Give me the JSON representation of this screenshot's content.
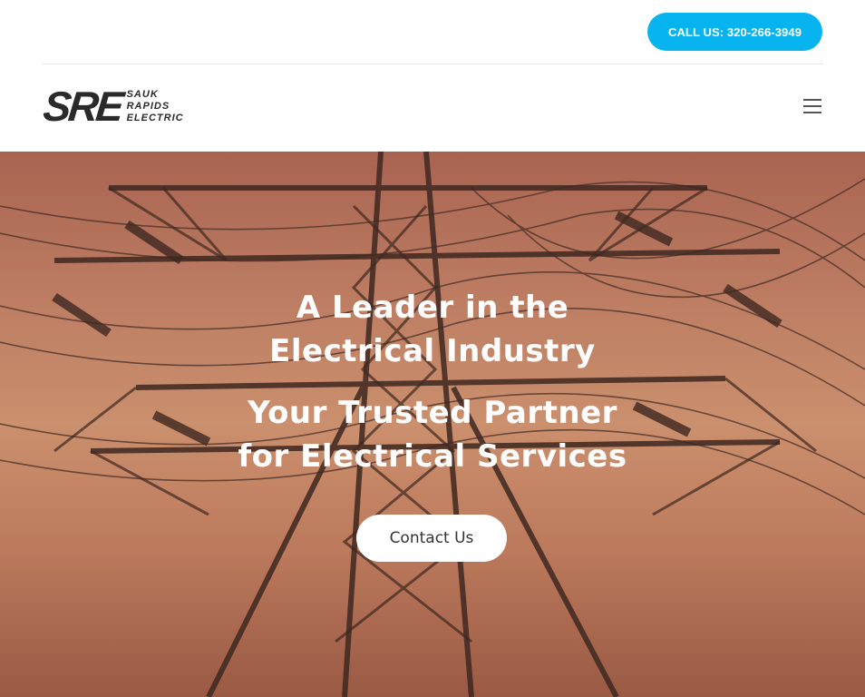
{
  "topbar": {
    "call_label": "CALL US: 320-266-3949"
  },
  "header": {
    "logo_mark": "SRE",
    "logo_words": [
      "SAUK",
      "RAPIDS",
      "ELECTRIC"
    ],
    "menu_icon": "hamburger-menu-icon"
  },
  "hero": {
    "headline": "A Leader in the Electrical Industry",
    "subheadline": "Your Trusted Partner for Electrical Services",
    "cta_label": "Contact Us",
    "image": "electrical-transmission-tower-sunset"
  },
  "colors": {
    "accent": "#08b4ef",
    "text_dark": "#2a2a2a",
    "hero_overlay": "#c98a6d"
  }
}
